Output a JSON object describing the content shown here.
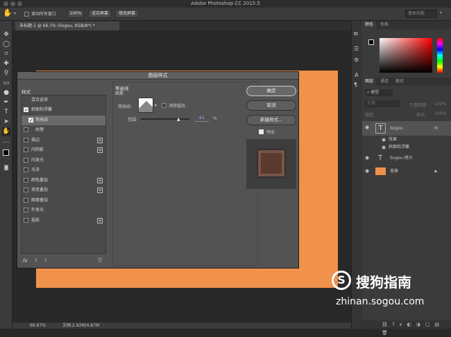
{
  "app": {
    "title": "Adobe Photoshop CC 2015.5"
  },
  "options": {
    "checkbox_label": "滚动所有窗口",
    "btn_zoom": "100%",
    "btn_fit": "适合屏幕",
    "btn_fill": "填充屏幕",
    "workspace": "基本功能"
  },
  "document": {
    "tab": "未标题-1 @ 66.7% (Sogou, RGB/8*) *"
  },
  "status": {
    "zoom": "66.67%",
    "doc": "文档:2.92M/4.87M"
  },
  "color_panel": {
    "tabs": [
      "颜色",
      "色板"
    ]
  },
  "layers_panel": {
    "tabs": [
      "图层",
      "通道",
      "路径"
    ],
    "kind": "类型",
    "blend": "正常",
    "opacity_label": "不透明度:",
    "opacity": "100%",
    "lock_label": "锁定:",
    "fill_label": "填充:",
    "fill": "100%",
    "layers": [
      {
        "name": "Sogou",
        "fx": "fx"
      },
      {
        "name": "效果"
      },
      {
        "name": "斜面和浮雕"
      },
      {
        "name": "Sogou 拷贝"
      },
      {
        "name": "背景"
      }
    ]
  },
  "dialog": {
    "title": "图层样式",
    "styles_header": "样式",
    "blend_options": "混合选项",
    "styles": [
      {
        "label": "斜面和浮雕",
        "checked": true
      },
      {
        "label": "等高线",
        "checked": true,
        "selected": true
      },
      {
        "label": "纹理",
        "checked": false
      },
      {
        "label": "描边",
        "checked": false,
        "plus": true
      },
      {
        "label": "内阴影",
        "checked": false,
        "plus": true
      },
      {
        "label": "内发光",
        "checked": false
      },
      {
        "label": "光泽",
        "checked": false
      },
      {
        "label": "颜色叠加",
        "checked": false,
        "plus": true
      },
      {
        "label": "渐变叠加",
        "checked": false,
        "plus": true
      },
      {
        "label": "图案叠加",
        "checked": false
      },
      {
        "label": "外发光",
        "checked": false
      },
      {
        "label": "投影",
        "checked": false,
        "plus": true
      }
    ],
    "fx": "fx",
    "section_title": "等高线",
    "section_sub": "图素",
    "contour_label": "等高线:",
    "antialias": "消除锯齿",
    "range_label": "范围:",
    "range_value": "61",
    "range_unit": "%",
    "ok": "确定",
    "cancel": "取消",
    "new_style": "新建样式...",
    "preview": "预览"
  },
  "watermark": {
    "brand": "搜狗指南",
    "url": "zhinan.sogou.com"
  }
}
